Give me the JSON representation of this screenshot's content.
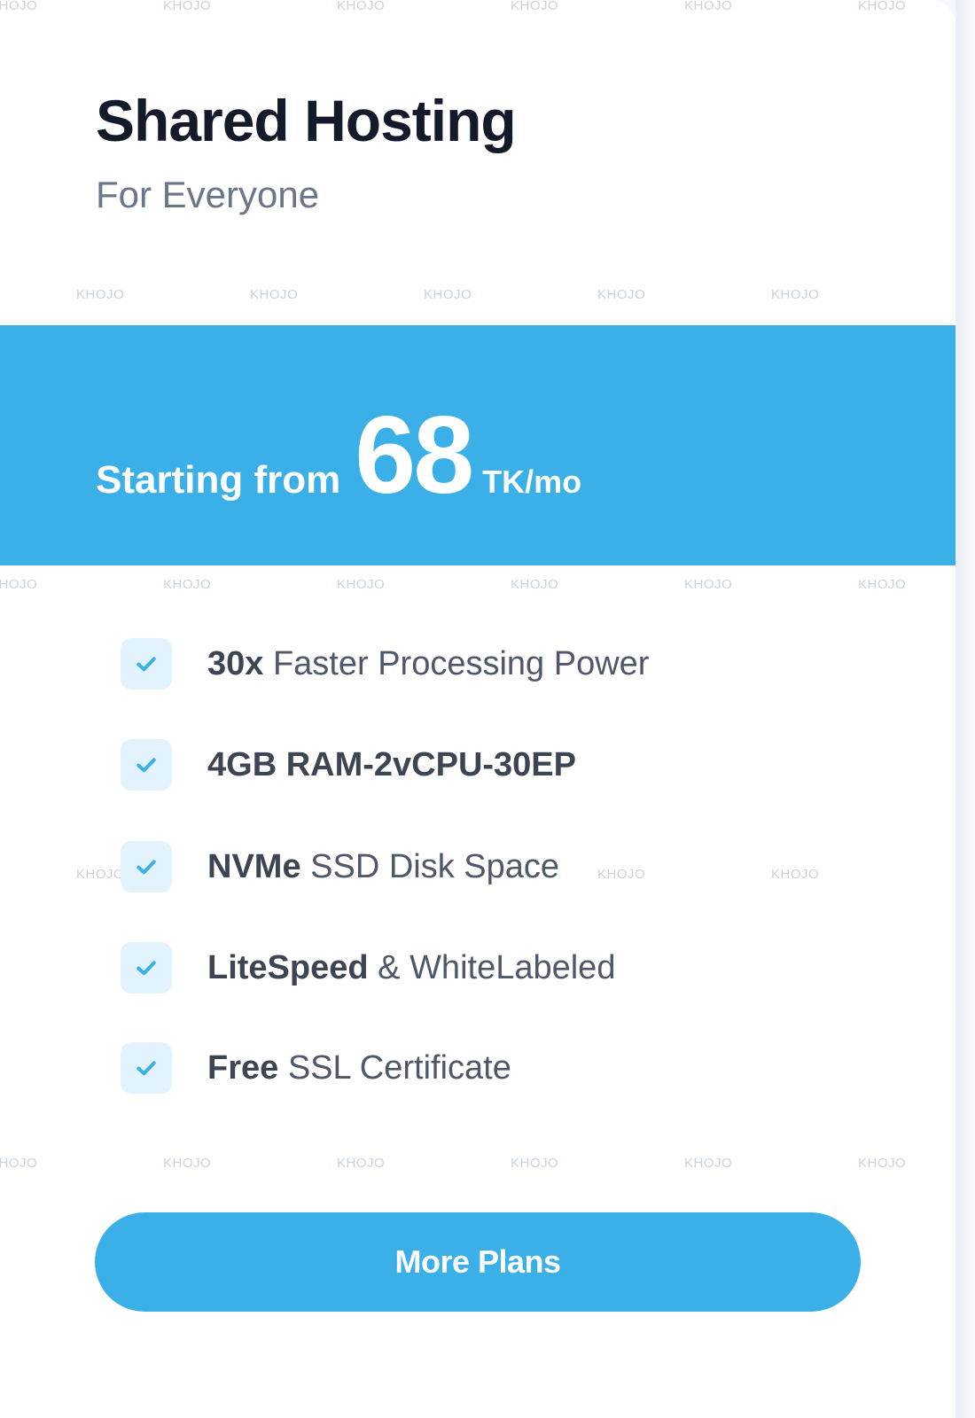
{
  "plan": {
    "title": "Shared Hosting",
    "subtitle": "For Everyone"
  },
  "price": {
    "prefix": "Starting from",
    "amount": "68",
    "unit": "TK/mo"
  },
  "features": [
    {
      "bold": "30x",
      "rest": " Faster Processing Power"
    },
    {
      "bold": "4GB RAM-2vCPU-30EP",
      "rest": ""
    },
    {
      "bold": "NVMe",
      "rest": " SSD Disk Space"
    },
    {
      "bold": "LiteSpeed",
      "rest": " & WhiteLabeled"
    },
    {
      "bold": "Free",
      "rest": " SSL Certificate"
    }
  ],
  "cta": {
    "label": "More Plans"
  },
  "watermark": "KHOJO",
  "colors": {
    "accent": "#3aafe8",
    "title": "#141a2a",
    "subtitle": "#6b7789",
    "check_bg": "#e3f3fd",
    "check_icon": "#3aafe8"
  },
  "icons": {
    "feature_check": "check-icon"
  }
}
